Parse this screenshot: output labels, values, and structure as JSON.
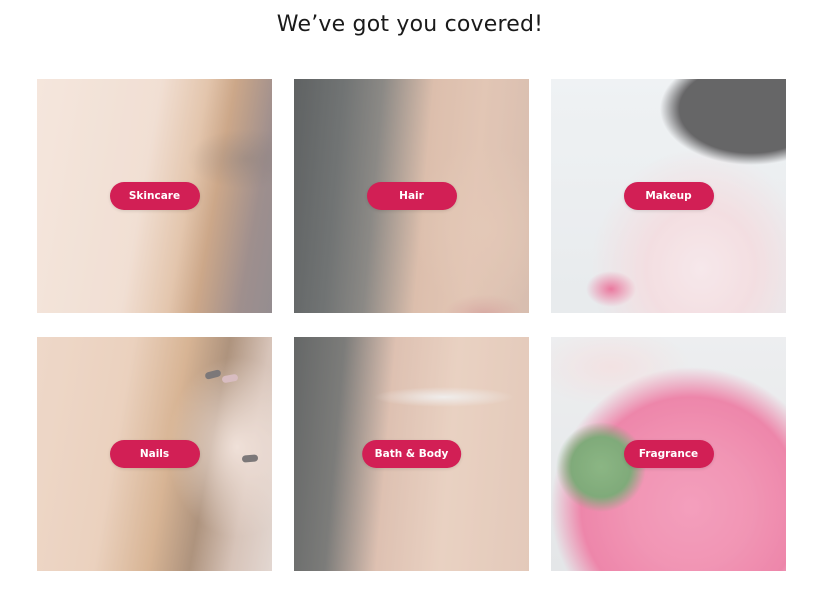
{
  "heading": "We’ve got you covered!",
  "categories": [
    {
      "label": "Skincare"
    },
    {
      "label": "Hair"
    },
    {
      "label": "Makeup"
    },
    {
      "label": "Nails"
    },
    {
      "label": "Bath & Body"
    },
    {
      "label": "Fragrance"
    }
  ],
  "colors": {
    "accent": "#d21f55",
    "text": "#1a1a1a",
    "background": "#ffffff"
  }
}
